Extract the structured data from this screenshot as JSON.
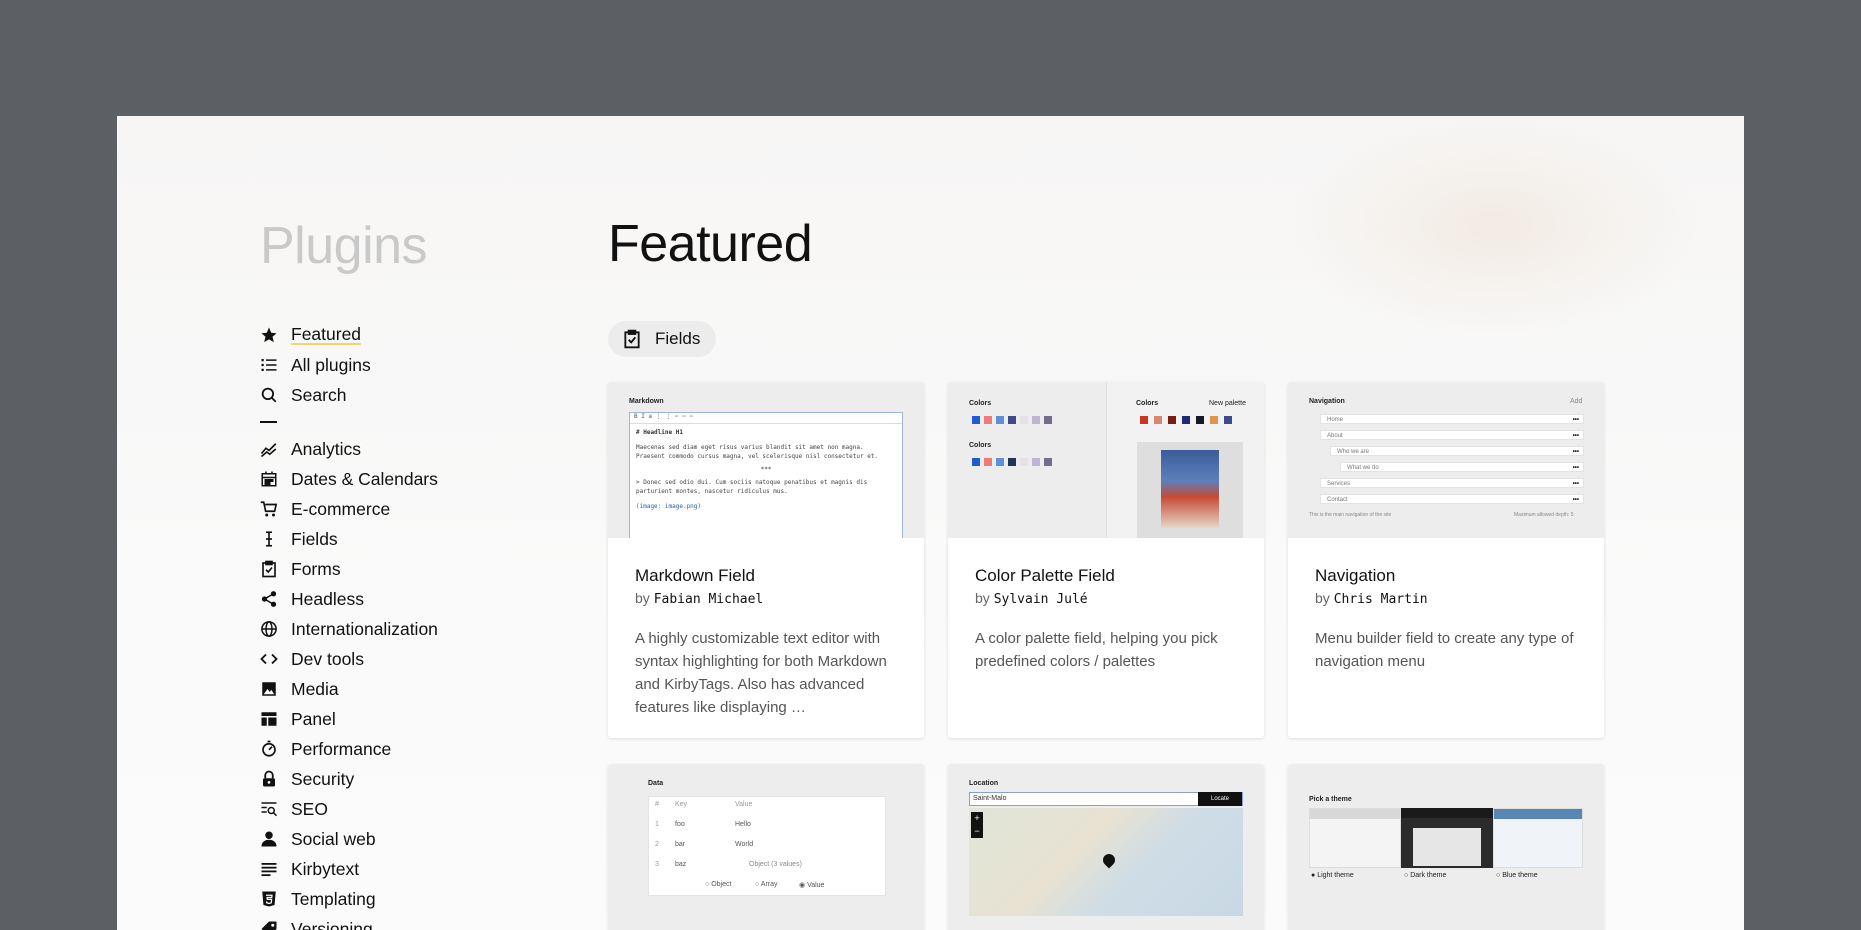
{
  "sidebar": {
    "title": "Plugins",
    "items": [
      {
        "label": "Featured",
        "icon": "star-icon",
        "active": true
      },
      {
        "label": "All plugins",
        "icon": "list-icon"
      },
      {
        "label": "Search",
        "icon": "search-icon"
      }
    ],
    "categories": [
      {
        "label": "Analytics",
        "icon": "chart-line-icon"
      },
      {
        "label": "Dates & Calendars",
        "icon": "calendar-icon"
      },
      {
        "label": "E-commerce",
        "icon": "cart-icon"
      },
      {
        "label": "Fields",
        "icon": "input-cursor-icon"
      },
      {
        "label": "Forms",
        "icon": "clipboard-check-icon"
      },
      {
        "label": "Headless",
        "icon": "share-icon"
      },
      {
        "label": "Internationalization",
        "icon": "globe-icon"
      },
      {
        "label": "Dev tools",
        "icon": "code-icon"
      },
      {
        "label": "Media",
        "icon": "image-icon"
      },
      {
        "label": "Panel",
        "icon": "layout-icon"
      },
      {
        "label": "Performance",
        "icon": "stopwatch-icon"
      },
      {
        "label": "Security",
        "icon": "lock-icon"
      },
      {
        "label": "SEO",
        "icon": "seo-search-icon"
      },
      {
        "label": "Social web",
        "icon": "user-icon"
      },
      {
        "label": "Kirbytext",
        "icon": "text-lines-icon"
      },
      {
        "label": "Templating",
        "icon": "html-icon"
      },
      {
        "label": "Versioning",
        "icon": "tag-icon"
      }
    ]
  },
  "main": {
    "title": "Featured",
    "chip": {
      "label": "Fields",
      "icon": "clipboard-check-icon"
    },
    "cards": [
      {
        "name": "Markdown Field",
        "by": "by",
        "author": "Fabian Michael",
        "desc": "A highly customizable text editor with syntax highlighting for both Markdown and KirbyTags. Also has advanced features like displaying …"
      },
      {
        "name": "Color Palette Field",
        "by": "by",
        "author": "Sylvain Julé",
        "desc": "A color palette field, helping you pick predefined colors / palettes"
      },
      {
        "name": "Navigation",
        "by": "by",
        "author": "Chris Martin",
        "desc": "Menu builder field to create any type of navigation menu"
      }
    ],
    "thumbs": {
      "markdown": {
        "label": "Markdown",
        "heading": "# Headline H1",
        "para": "Maecenas sed diam eget risus varius blandit sit amet non magna. Praesent commodo cursus magna, vel scelerisque nisl consectetur et.",
        "quote": "> Donec sed odio dui. Cum sociis natoque penatibus et magnis dis parturient montes, nascetur ridiculus mus.",
        "image": "(image: image.png)"
      },
      "colors": {
        "label_left": "Colors",
        "label_left2": "Colors",
        "label_right": "Colors",
        "new_palette": "New palette"
      },
      "navigation": {
        "label": "Navigation",
        "add": "Add",
        "rows": [
          "Home",
          "About",
          "Who we are",
          "What we do",
          "Services",
          "Contact"
        ],
        "footer_left": "This is the main navigation of the site",
        "footer_right": "Maximum allowed depth: 5"
      },
      "data": {
        "label": "Data",
        "col_num": "#",
        "col_key": "Key",
        "col_value": "Value",
        "rows": [
          {
            "n": "1",
            "key": "foo",
            "value": "Hello"
          },
          {
            "n": "2",
            "key": "bar",
            "value": "World"
          },
          {
            "n": "3",
            "key": "baz",
            "value": "Object (3 values)"
          }
        ],
        "opt_object": "Object",
        "opt_array": "Array",
        "opt_value": "Value"
      },
      "location": {
        "label": "Location",
        "query": "Saint-Malo",
        "button": "Locate"
      },
      "theme": {
        "label": "Pick a theme",
        "options": [
          "Light theme",
          "Dark theme",
          "Blue theme"
        ]
      }
    }
  }
}
